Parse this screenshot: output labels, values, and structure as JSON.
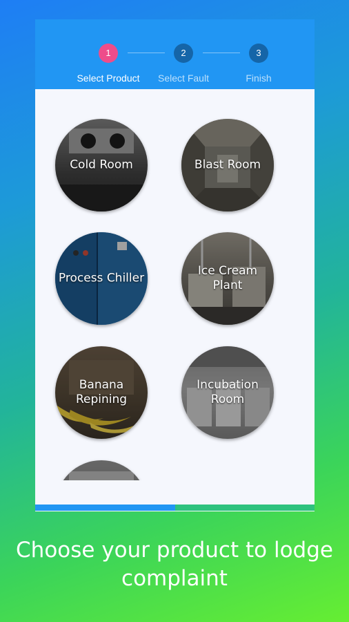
{
  "header": {
    "steps": [
      {
        "number": "1",
        "label": "Select Product",
        "active": true
      },
      {
        "number": "2",
        "label": "Select Fault",
        "active": false
      },
      {
        "number": "3",
        "label": "Finish",
        "active": false
      }
    ]
  },
  "products": [
    {
      "label": "Cold Room"
    },
    {
      "label": "Blast Room"
    },
    {
      "label": "Process Chiller"
    },
    {
      "label": "Ice Cream\nPlant"
    },
    {
      "label": "Banana\nRepining"
    },
    {
      "label": "Incubation\nRoom"
    }
  ],
  "progress": {
    "fraction": 0.5
  },
  "caption": "Choose your product to lodge complaint",
  "colors": {
    "header": "#2196f3",
    "active_step": "#ee4d8a",
    "inactive_step": "#1565a8",
    "progress_done": "#2196f3",
    "progress_rest": "#2ec27e"
  }
}
